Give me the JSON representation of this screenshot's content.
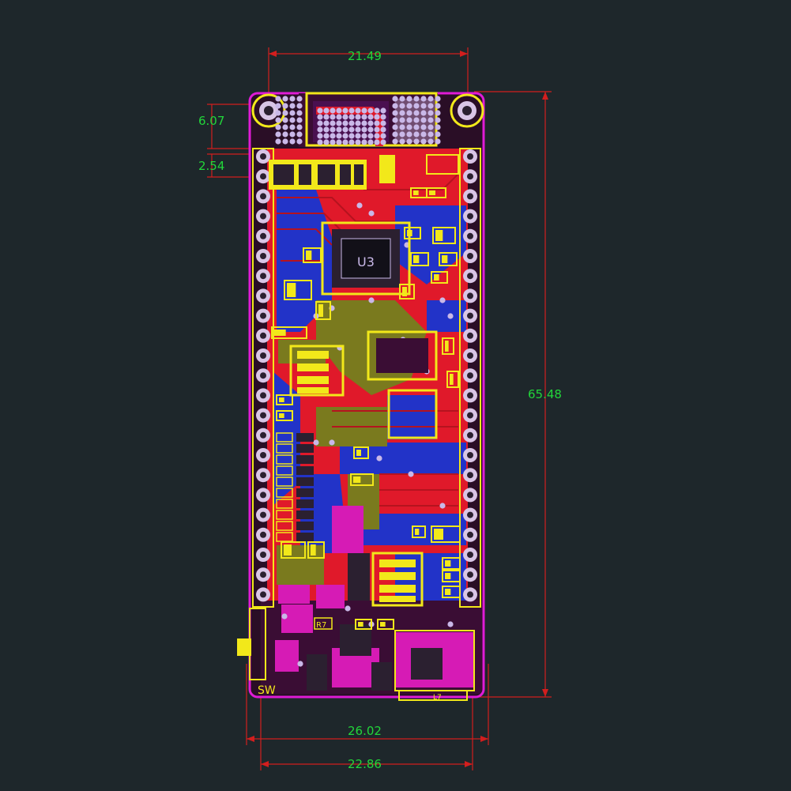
{
  "colors": {
    "background": "#1e272b",
    "dimension_line": "#d21e1e",
    "dimension_text": "#22d63a",
    "board_outline": "#e01bd6",
    "copper_top": "#e0192a",
    "copper_bottom": "#2233c8",
    "silkscreen": "#f2e81a",
    "pad": "#d9c5e6",
    "via": "#c9b8e8",
    "fill_dark": "#7a7a1e",
    "magenta_pour": "#d61bb5",
    "chip_body": "#2b2030"
  },
  "dimensions": {
    "top_width": "21.49",
    "hole_offset": "6.07",
    "pin_pitch": "2.54",
    "height": "65.48",
    "board_width": "26.02",
    "header_width": "22.86"
  },
  "board": {
    "labels": {
      "u3": "U3",
      "sw": "SW",
      "r7": "R7",
      "l7": "L7"
    }
  }
}
